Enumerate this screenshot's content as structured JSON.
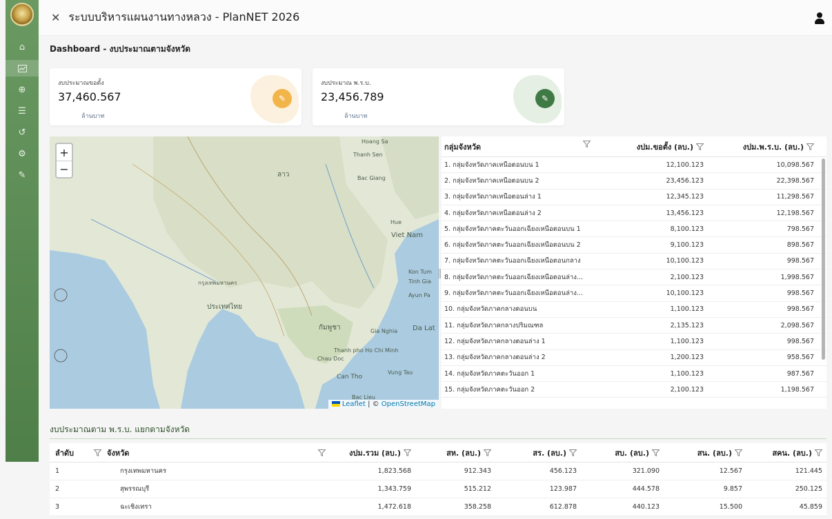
{
  "header": {
    "title": "ระบบบริหารแผนงานทางหลวง - PlanNET 2026"
  },
  "page_title": "Dashboard - งบประมาณตามจังหวัด",
  "sidebar": {
    "icons": [
      "home-icon",
      "chart-icon",
      "plus-circle-icon",
      "list-icon",
      "history-icon",
      "settings-icon",
      "tools-icon"
    ]
  },
  "cards": [
    {
      "label": "งบประมาณขอตั้ง",
      "value": "37,460.567",
      "unit": "ล้านบาท",
      "color": "#f2b54a"
    },
    {
      "label": "งบประมาณ พ.ร.บ.",
      "value": "23,456.789",
      "unit": "ล้านบาท",
      "color": "#3f7a45"
    }
  ],
  "map": {
    "zoom_in": "+",
    "zoom_out": "−",
    "attribution_leaflet": "Leaflet",
    "attribution_sep": " | © ",
    "attribution_osm": "OpenStreetMap",
    "labels": [
      "Hoang Sa",
      "Thanh Sen",
      "Bac Giang",
      "Hue",
      "Viet Nam",
      "Kon Tum",
      "Tinh Gia",
      "Ayun Pa",
      "Da Lat",
      "Gia Nghia",
      "Thanh pho Ho Chi Minh",
      "Chau Doc",
      "Can Tho",
      "Vung Tau",
      "Bac Lieu",
      "กรุงเทพมหานคร",
      "ประเทศไทย",
      "กัมพูชา",
      "ลาว"
    ]
  },
  "province_groups": {
    "headers": {
      "group": "กลุ่มจังหวัด",
      "requested": "งปม.ขอตั้ง (ลบ.)",
      "approved": "งปม.พ.ร.บ. (ลบ.)"
    },
    "rows": [
      {
        "group": "1. กลุ่มจังหวัดภาคเหนือตอนบน 1",
        "requested": "12,100.123",
        "approved": "10,098.567"
      },
      {
        "group": "2. กลุ่มจังหวัดภาคเหนือตอนบน 2",
        "requested": "23,456.123",
        "approved": "22,398.567"
      },
      {
        "group": "3. กลุ่มจังหวัดภาคเหนือตอนล่าง 1",
        "requested": "12,345.123",
        "approved": "11,298.567"
      },
      {
        "group": "4. กลุ่มจังหวัดภาคเหนือตอนล่าง 2",
        "requested": "13,456.123",
        "approved": "12,198.567"
      },
      {
        "group": "5. กลุ่มจังหวัดภาคตะวันออกเฉียงเหนือตอนบน 1",
        "requested": "8,100.123",
        "approved": "798.567"
      },
      {
        "group": "6. กลุ่มจังหวัดภาคตะวันออกเฉียงเหนือตอนบน 2",
        "requested": "9,100.123",
        "approved": "898.567"
      },
      {
        "group": "7. กลุ่มจังหวัดภาคตะวันออกเฉียงเหนือตอนกลาง",
        "requested": "10,100.123",
        "approved": "998.567"
      },
      {
        "group": "8. กลุ่มจังหวัดภาคตะวันออกเฉียงเหนือตอนล่าง...",
        "requested": "2,100.123",
        "approved": "1,998.567"
      },
      {
        "group": "9. กลุ่มจังหวัดภาคตะวันออกเฉียงเหนือตอนล่าง...",
        "requested": "10,100.123",
        "approved": "998.567"
      },
      {
        "group": "10. กลุ่มจังหวัดภาคกลางตอนบน",
        "requested": "1,100.123",
        "approved": "998.567"
      },
      {
        "group": "11. กลุ่มจังหวัดภาคกลางปริมณฑล",
        "requested": "2,135.123",
        "approved": "2,098.567"
      },
      {
        "group": "12. กลุ่มจังหวัดภาคกลางตอนล่าง 1",
        "requested": "1,100.123",
        "approved": "998.567"
      },
      {
        "group": "13. กลุ่มจังหวัดภาคกลางตอนล่าง 2",
        "requested": "1,200.123",
        "approved": "958.567"
      },
      {
        "group": "14. กลุ่มจังหวัดภาคตะวันออก 1",
        "requested": "1,100.123",
        "approved": "987.567"
      },
      {
        "group": "15. กลุ่มจังหวัดภาคตะวันออก 2",
        "requested": "2,100.123",
        "approved": "1,198.567"
      }
    ]
  },
  "province_budget": {
    "title": "งบประมาณตาม พ.ร.บ. แยกตามจังหวัด",
    "headers": {
      "no": "ลำดับ",
      "province": "จังหวัด",
      "total": "งปม.รวม (ลบ.)",
      "sh": "สห. (ลบ.)",
      "sr": "สร. (ลบ.)",
      "sb": "สบ. (ลบ.)",
      "sp": "สน. (ลบ.)",
      "skn": "สคน. (ลบ.)"
    },
    "rows": [
      {
        "no": "1",
        "province": "กรุงเทพมหานคร",
        "total": "1,823.568",
        "sh": "912.343",
        "sr": "456.123",
        "sb": "321.090",
        "sp": "12.567",
        "skn": "121.445"
      },
      {
        "no": "2",
        "province": "สุพรรณบุรี",
        "total": "1,343.759",
        "sh": "515.212",
        "sr": "123.987",
        "sb": "444.578",
        "sp": "9.857",
        "skn": "250.125"
      },
      {
        "no": "3",
        "province": "ฉะเชิงเทรา",
        "total": "1,472.618",
        "sh": "358.258",
        "sr": "612.878",
        "sb": "440.123",
        "sp": "15.500",
        "skn": "45.859"
      }
    ]
  }
}
